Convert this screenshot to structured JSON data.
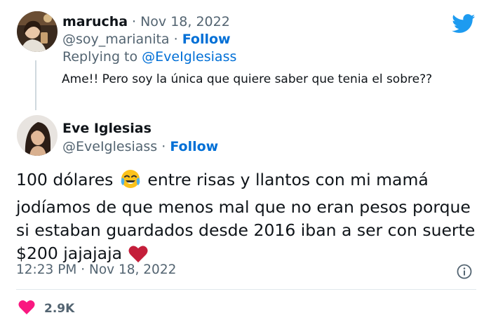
{
  "reply": {
    "author_name": "marucha",
    "date": "Nov 18, 2022",
    "handle": "@soy_marianita",
    "follow_label": "Follow",
    "replying_to_prefix": "Replying to",
    "replying_to_handle": "@EveIglesiass",
    "text": "Ame!! Pero soy la única que quiere saber que tenia el sobre??"
  },
  "tweet": {
    "author_name": "Eve Iglesias",
    "handle": "@EveIglesiass",
    "follow_label": "Follow",
    "text_part1": "100 dólares",
    "text_part2": "entre risas y llantos con mi mamá jodíamos de que menos mal que no eran pesos porque si estaban guardados desde 2016 iban a ser con suerte $200 jajajaja",
    "emoji_1": "face-with-tears-of-joy",
    "emoji_2": "red-heart",
    "time": "12:23 PM",
    "date": "Nov 18, 2022",
    "like_count": "2.9K"
  },
  "icons": {
    "brand": "twitter-bird-icon",
    "info": "info-icon",
    "like": "heart-icon"
  },
  "colors": {
    "brand_blue": "#1d9bf0",
    "link_blue": "#006fd6",
    "text_primary": "#0f1419",
    "text_secondary": "#536471",
    "like_pink": "#f91880",
    "heart_red": "#c41e3a"
  }
}
